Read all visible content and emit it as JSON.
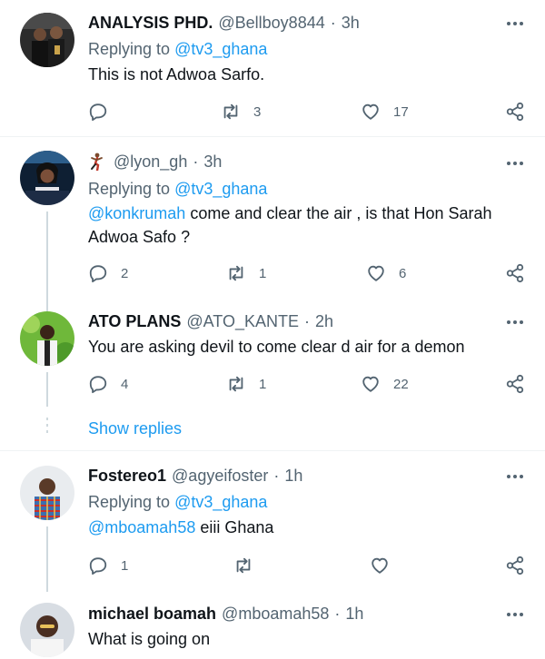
{
  "tweets": [
    {
      "name": "ANALYSIS PHD.",
      "handle": "@Bellboy8844",
      "separator": "·",
      "time": "3h",
      "replying_label": "Replying to",
      "replying_to": "@tv3_ghana",
      "text": "This is not Adwoa Sarfo.",
      "replies": "",
      "retweets": "3",
      "likes": "17"
    },
    {
      "name": "",
      "emoji_icon": "dancing-figure-icon",
      "handle": "@lyon_gh",
      "separator": "·",
      "time": "3h",
      "replying_label": "Replying to",
      "replying_to": "@tv3_ghana",
      "mention": "@konkrumah",
      "text_line1": " come and clear the air , is that Hon Sarah",
      "text_line2": "Adwoa Safo ?",
      "replies": "2",
      "retweets": "1",
      "likes": "6"
    },
    {
      "name": "ATO PLANS",
      "handle": "@ATO_KANTE",
      "separator": "·",
      "time": "2h",
      "text": "You are asking devil to come clear d air for  a demon",
      "replies": "4",
      "retweets": "1",
      "likes": "22"
    },
    {
      "name": "Fostereo1",
      "handle": "@agyeifoster",
      "separator": "·",
      "time": "1h",
      "replying_label": "Replying to",
      "replying_to": "@tv3_ghana",
      "mention": "@mboamah58",
      "text": " eiii Ghana",
      "replies": "1",
      "retweets": "",
      "likes": ""
    },
    {
      "name": "michael boamah",
      "handle": "@mboamah58",
      "separator": "·",
      "time": "1h",
      "text": "What is going on"
    }
  ],
  "show_replies": "Show replies",
  "colors": {
    "link": "#1d9bf0",
    "secondary": "#536471",
    "divider": "#eff3f4",
    "thread": "#cfd9de"
  }
}
